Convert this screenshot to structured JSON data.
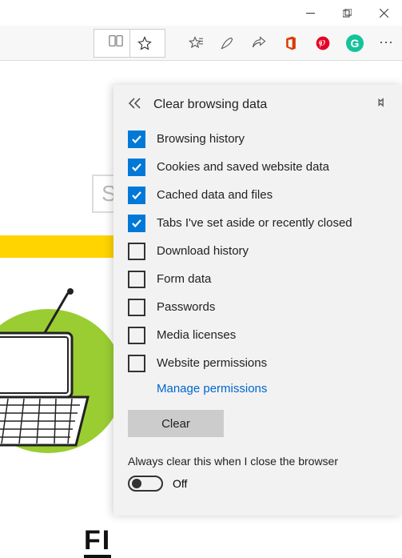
{
  "titlebar": {
    "minimize": "—",
    "maximize": "❐",
    "close": "✕"
  },
  "toolbar": {
    "icons": {
      "reading": "reading-view",
      "favorite": "star",
      "favs_list": "star-lines",
      "notes": "pen",
      "share": "share",
      "office": "office",
      "pinterest": "pinterest",
      "grammarly": "G",
      "more": "⋯"
    }
  },
  "page": {
    "search_placeholder": "S",
    "headline_fragment": "FI"
  },
  "panel": {
    "title": "Clear browsing data",
    "items": [
      {
        "label": "Browsing history",
        "checked": true
      },
      {
        "label": "Cookies and saved website data",
        "checked": true
      },
      {
        "label": "Cached data and files",
        "checked": true
      },
      {
        "label": "Tabs I've set aside or recently closed",
        "checked": true
      },
      {
        "label": "Download history",
        "checked": false
      },
      {
        "label": "Form data",
        "checked": false
      },
      {
        "label": "Passwords",
        "checked": false
      },
      {
        "label": "Media licenses",
        "checked": false
      },
      {
        "label": "Website permissions",
        "checked": false
      }
    ],
    "manage_link": "Manage permissions",
    "clear_button": "Clear",
    "always_label": "Always clear this when I close the browser",
    "toggle_state": "Off"
  }
}
